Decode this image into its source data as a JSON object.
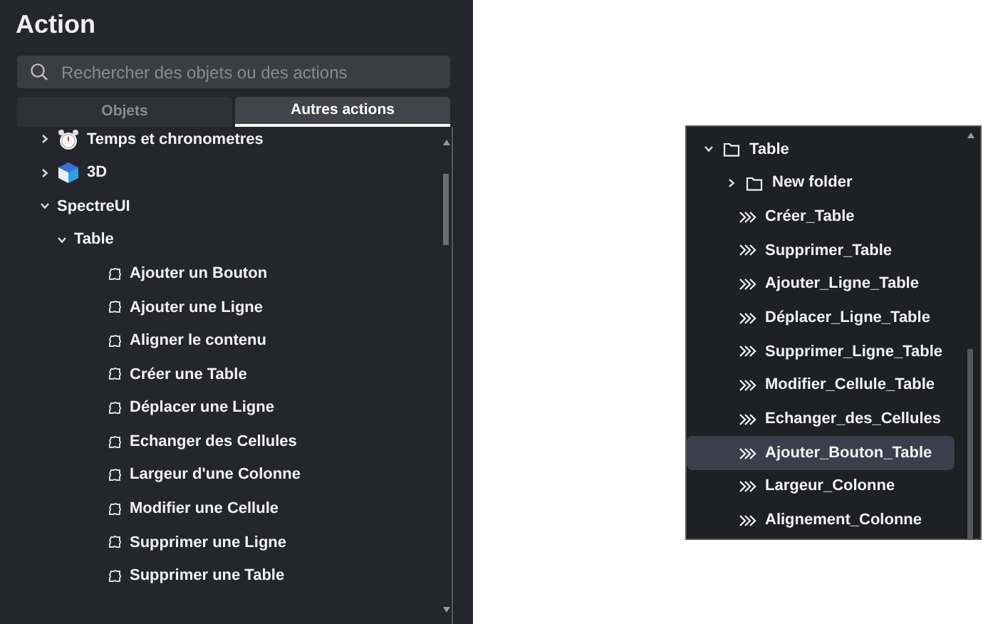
{
  "panel": {
    "title": "Action",
    "search": {
      "placeholder": "Rechercher des objets ou des actions"
    },
    "tabs": [
      {
        "label": "Objets",
        "selected": false
      },
      {
        "label": "Autres actions",
        "selected": true
      }
    ],
    "tree": [
      {
        "label": "Temps et chronometres",
        "kind": "clock",
        "expanded": false
      },
      {
        "label": "3D",
        "kind": "cube",
        "expanded": false
      },
      {
        "label": "SpectreUI",
        "expanded": true,
        "children": [
          {
            "label": "Table",
            "expanded": true,
            "children": [
              {
                "label": "Ajouter un Bouton",
                "kind": "action"
              },
              {
                "label": "Ajouter une Ligne",
                "kind": "action"
              },
              {
                "label": "Aligner le contenu",
                "kind": "action"
              },
              {
                "label": "Créer une Table",
                "kind": "action"
              },
              {
                "label": "Déplacer une Ligne",
                "kind": "action"
              },
              {
                "label": "Echanger des Cellules",
                "kind": "action"
              },
              {
                "label": "Largeur d'une Colonne",
                "kind": "action"
              },
              {
                "label": "Modifier une Cellule",
                "kind": "action"
              },
              {
                "label": "Supprimer une Ligne",
                "kind": "action"
              },
              {
                "label": "Supprimer une Table",
                "kind": "action"
              }
            ]
          }
        ]
      }
    ]
  },
  "functions_tree": [
    {
      "label": "Table",
      "kind": "folder",
      "expanded": true,
      "children": [
        {
          "label": "New folder",
          "kind": "folder",
          "expanded": false
        },
        {
          "label": "Créer_Table",
          "kind": "function",
          "selected": false
        },
        {
          "label": "Supprimer_Table",
          "kind": "function",
          "selected": false
        },
        {
          "label": "Ajouter_Ligne_Table",
          "kind": "function",
          "selected": false
        },
        {
          "label": "Déplacer_Ligne_Table",
          "kind": "function",
          "selected": false
        },
        {
          "label": "Supprimer_Ligne_Table",
          "kind": "function",
          "selected": false
        },
        {
          "label": "Modifier_Cellule_Table",
          "kind": "function",
          "selected": false
        },
        {
          "label": "Echanger_des_Cellules",
          "kind": "function",
          "selected": false
        },
        {
          "label": "Ajouter_Bouton_Table",
          "kind": "function",
          "selected": true
        },
        {
          "label": "Largeur_Colonne",
          "kind": "function",
          "selected": false
        },
        {
          "label": "Alignement_Colonne",
          "kind": "function",
          "selected": false
        }
      ]
    }
  ]
}
